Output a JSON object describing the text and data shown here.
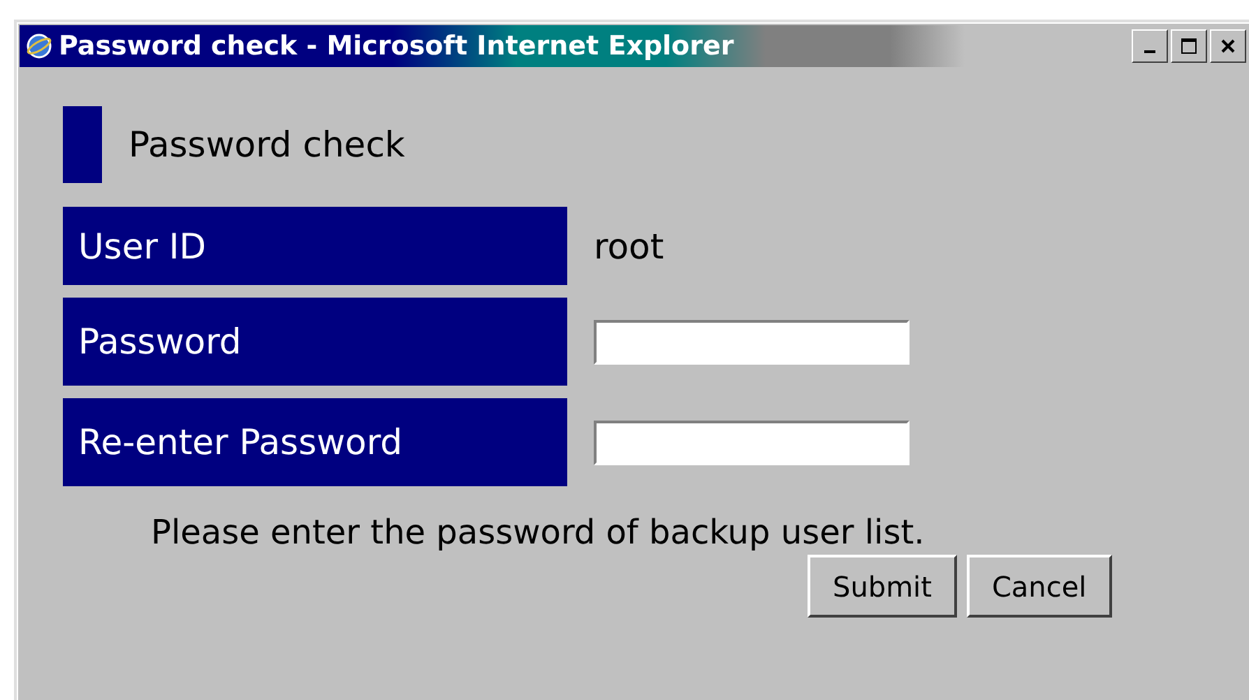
{
  "window": {
    "title": "Password check - Microsoft Internet Explorer"
  },
  "heading": "Password check",
  "fields": [
    {
      "label": "User ID",
      "kind": "text",
      "value": "root"
    },
    {
      "label": "Password",
      "kind": "input"
    },
    {
      "label": "Re-enter Password",
      "kind": "input"
    }
  ],
  "message": "Please enter the password of backup user list.",
  "buttons": [
    "Submit",
    "Cancel"
  ]
}
